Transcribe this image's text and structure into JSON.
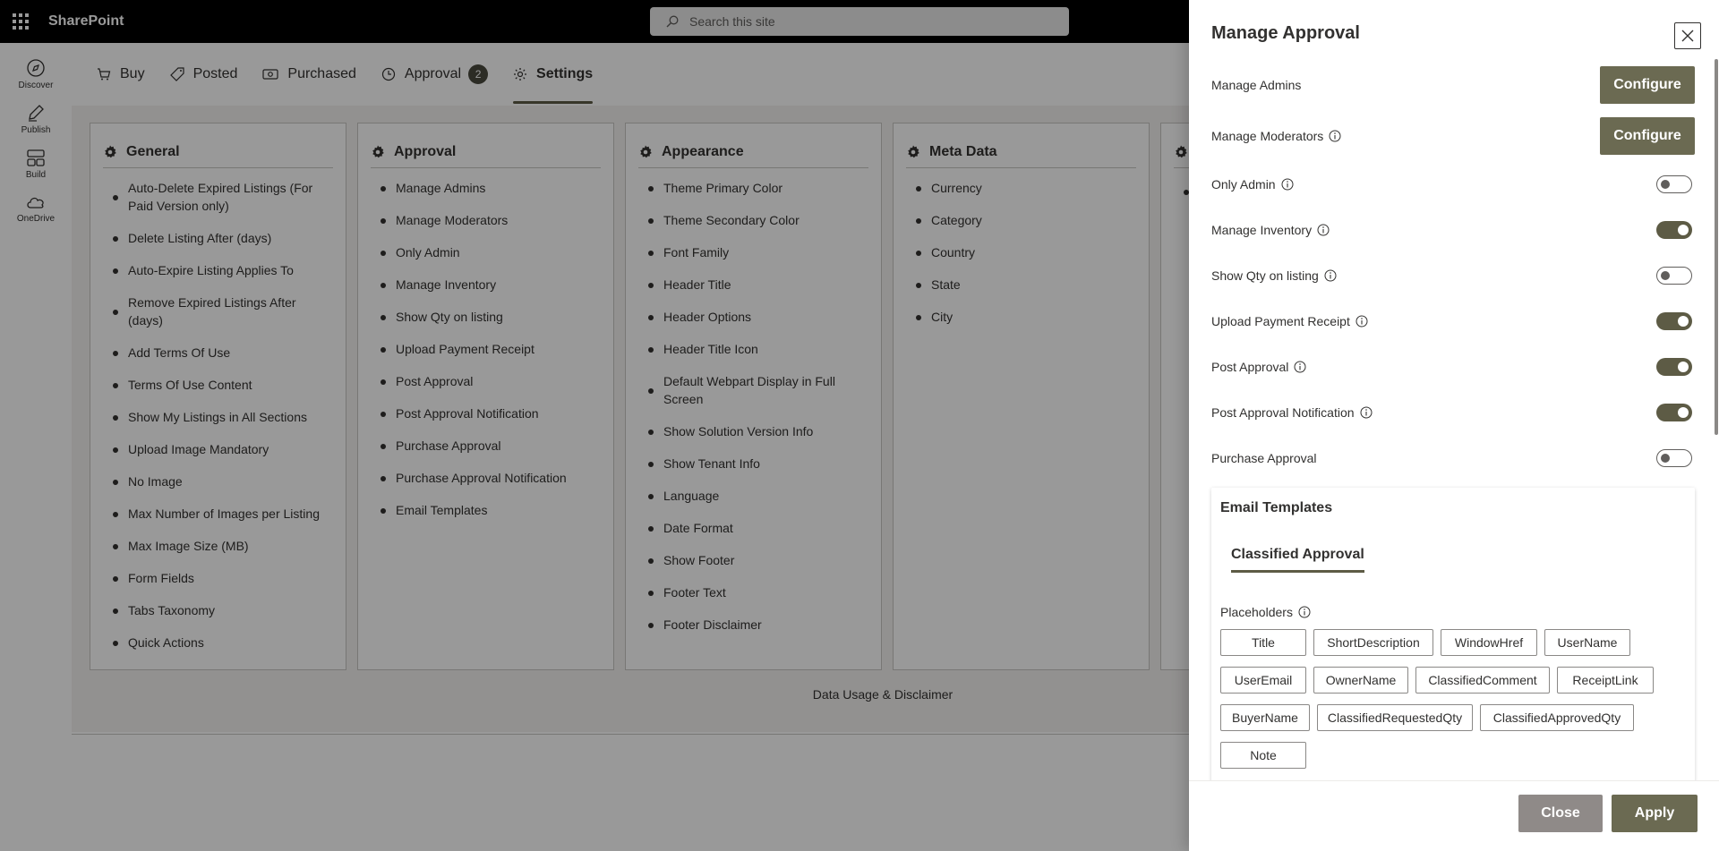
{
  "app": {
    "brand": "SharePoint"
  },
  "search": {
    "placeholder": "Search this site"
  },
  "rail": {
    "items": [
      {
        "label": "Discover",
        "icon": "compass-icon"
      },
      {
        "label": "Publish",
        "icon": "pen-icon"
      },
      {
        "label": "Build",
        "icon": "layout-icon"
      },
      {
        "label": "OneDrive",
        "icon": "cloud-icon"
      }
    ]
  },
  "tabs": [
    {
      "label": "Buy",
      "icon": "cart-icon"
    },
    {
      "label": "Posted",
      "icon": "tag-icon"
    },
    {
      "label": "Purchased",
      "icon": "money-icon"
    },
    {
      "label": "Approval",
      "icon": "clock-icon",
      "badge": "2"
    },
    {
      "label": "Settings",
      "icon": "gear-icon",
      "active": true
    }
  ],
  "cards": [
    {
      "title": "General",
      "items": [
        "Auto-Delete Expired Listings (For Paid Version only)",
        "Delete Listing After (days)",
        "Auto-Expire Listing Applies To",
        "Remove Expired Listings After (days)",
        "Add Terms Of Use",
        "Terms Of Use Content",
        "Show My Listings in All Sections",
        "Upload Image Mandatory",
        "No Image",
        "Max Number of Images per Listing",
        "Max Image Size (MB)",
        "Form Fields",
        "Tabs Taxonomy",
        "Quick Actions"
      ]
    },
    {
      "title": "Approval",
      "items": [
        "Manage Admins",
        "Manage Moderators",
        "Only Admin",
        "Manage Inventory",
        "Show Qty on listing",
        "Upload Payment Receipt",
        "Post Approval",
        "Post Approval Notification",
        "Purchase Approval",
        "Purchase Approval Notification",
        "Email Templates"
      ]
    },
    {
      "title": "Appearance",
      "items": [
        "Theme Primary Color",
        "Theme Secondary Color",
        "Font Family",
        "Header Title",
        "Header Options",
        "Header Title Icon",
        "Default Webpart Display in Full Screen",
        "Show Solution Version Info",
        "Show Tenant Info",
        "Language",
        "Date Format",
        "Show Footer",
        "Footer Text",
        "Footer Disclaimer"
      ]
    },
    {
      "title": "Meta Data",
      "items": [
        "Currency",
        "Category",
        "Country",
        "State",
        "City"
      ]
    }
  ],
  "footer": {
    "link": "Data Usage & Disclaimer"
  },
  "panel": {
    "title": "Manage Approval",
    "rows": [
      {
        "label": "Manage Admins",
        "info": false,
        "control": "button",
        "button_label": "Configure"
      },
      {
        "label": "Manage Moderators",
        "info": true,
        "control": "button",
        "button_label": "Configure"
      },
      {
        "label": "Only Admin",
        "info": true,
        "control": "toggle",
        "on": false
      },
      {
        "label": "Manage Inventory",
        "info": true,
        "control": "toggle",
        "on": true
      },
      {
        "label": "Show Qty on listing",
        "info": true,
        "control": "toggle",
        "on": false
      },
      {
        "label": "Upload Payment Receipt",
        "info": true,
        "control": "toggle",
        "on": true
      },
      {
        "label": "Post Approval",
        "info": true,
        "control": "toggle",
        "on": true
      },
      {
        "label": "Post Approval Notification",
        "info": true,
        "control": "toggle",
        "on": true
      },
      {
        "label": "Purchase Approval",
        "info": false,
        "control": "toggle",
        "on": false
      }
    ],
    "email_templates": {
      "title": "Email Templates",
      "tab": "Classified Approval",
      "placeholders_label": "Placeholders",
      "chips": [
        "Title",
        "ShortDescription",
        "WindowHref",
        "UserName",
        "UserEmail",
        "OwnerName",
        "ClassifiedComment",
        "ReceiptLink",
        "BuyerName",
        "ClassifiedRequestedQty",
        "ClassifiedApprovedQty",
        "Note"
      ]
    },
    "close_label": "Close",
    "apply_label": "Apply"
  },
  "colors": {
    "accent": "#5d5b45",
    "button": "#6b6a52",
    "close_button": "#8f8a88"
  }
}
